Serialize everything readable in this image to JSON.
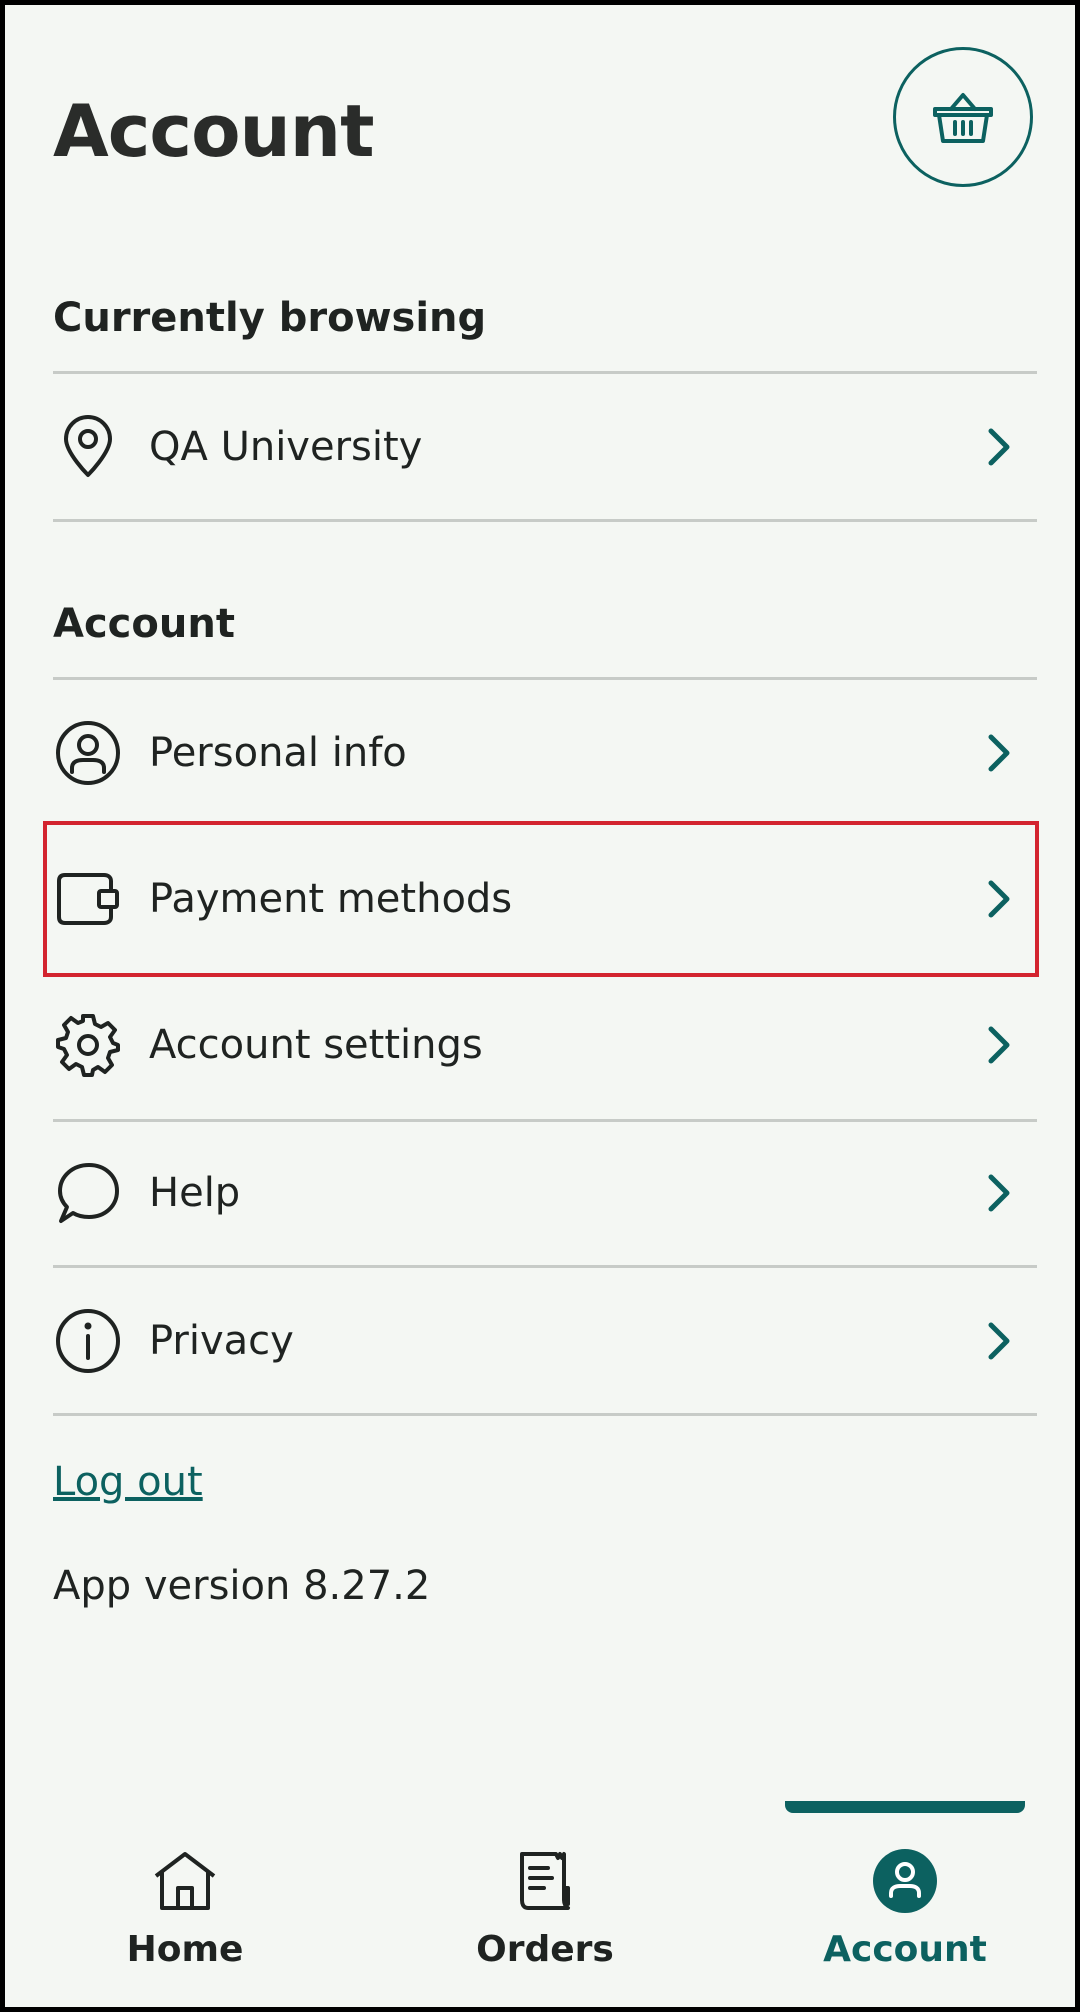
{
  "header": {
    "title": "Account",
    "cart_icon": "basket-icon"
  },
  "browsing": {
    "title": "Currently browsing",
    "location": {
      "label": "QA University",
      "icon": "location-pin-icon"
    }
  },
  "account": {
    "title": "Account",
    "items": [
      {
        "label": "Personal info",
        "icon": "user-circle-icon"
      },
      {
        "label": "Payment methods",
        "icon": "wallet-icon",
        "highlighted": true
      },
      {
        "label": "Account settings",
        "icon": "gear-icon"
      },
      {
        "label": "Help",
        "icon": "chat-bubble-icon"
      },
      {
        "label": "Privacy",
        "icon": "info-icon"
      }
    ]
  },
  "footer": {
    "logout": "Log out",
    "version": "App version 8.27.2"
  },
  "tabs": [
    {
      "label": "Home",
      "icon": "home-icon"
    },
    {
      "label": "Orders",
      "icon": "receipt-icon"
    },
    {
      "label": "Account",
      "icon": "account-icon",
      "active": true
    }
  ],
  "colors": {
    "accent": "#0c6160",
    "background": "#f4f7f3",
    "highlight": "#d3242f",
    "divider": "#c7cbc7"
  }
}
